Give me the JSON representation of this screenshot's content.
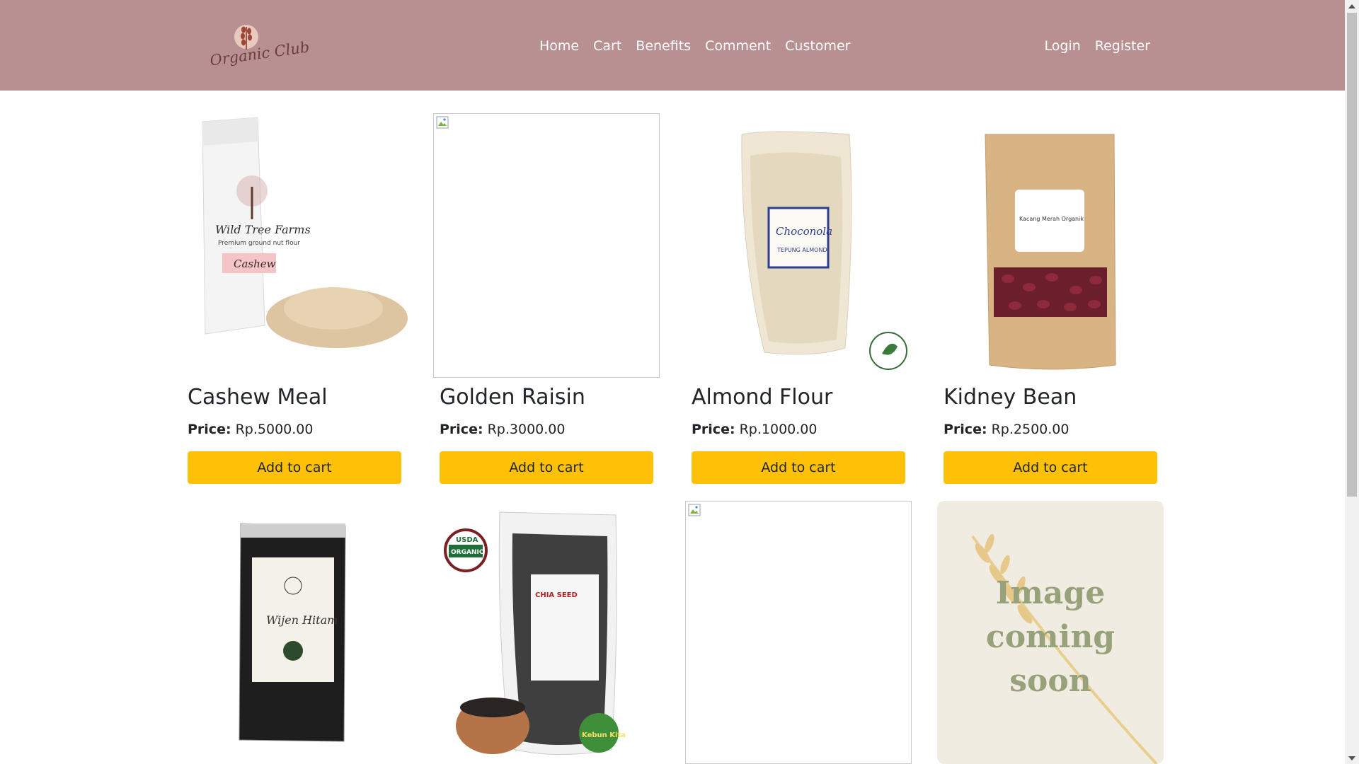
{
  "brand": {
    "name": "Organic Club"
  },
  "nav": {
    "links": [
      "Home",
      "Cart",
      "Benefits",
      "Comment",
      "Customer"
    ],
    "auth": [
      "Login",
      "Register"
    ]
  },
  "products": [
    {
      "name": "Cashew Meal",
      "price_label": "Price:",
      "price": "Rp.5000.00",
      "button": "Add to cart",
      "image": "cashew-meal-bag",
      "package_text": [
        "Wild Tree Farms",
        "Premium ground nut flour",
        "Cashew"
      ]
    },
    {
      "name": "Golden Raisin",
      "price_label": "Price:",
      "price": "Rp.3000.00",
      "button": "Add to cart",
      "image": "broken-image"
    },
    {
      "name": "Almond Flour",
      "price_label": "Price:",
      "price": "Rp.1000.00",
      "button": "Add to cart",
      "image": "almond-flour-bag",
      "package_text": [
        "Choconola",
        "TEPUNG ALMOND"
      ]
    },
    {
      "name": "Kidney Bean",
      "price_label": "Price:",
      "price": "Rp.2500.00",
      "button": "Add to cart",
      "image": "kidney-bean-bag",
      "package_text": [
        "Kacang Merah Organik"
      ]
    }
  ],
  "products_row2": [
    {
      "image": "black-sesame-bag",
      "package_text": [
        "Wijen Hitam"
      ]
    },
    {
      "image": "chia-seed-bag",
      "package_text": [
        "USDA",
        "ORGANIC",
        "CHIA SEED",
        "Kebun Kita"
      ]
    },
    {
      "image": "broken-image"
    },
    {
      "image": "image-coming-soon",
      "package_text": [
        "Image",
        "coming",
        "soon"
      ]
    }
  ],
  "colors": {
    "navbar": "#b99092",
    "button": "#ffc107",
    "nav_text": "#ffffff"
  }
}
